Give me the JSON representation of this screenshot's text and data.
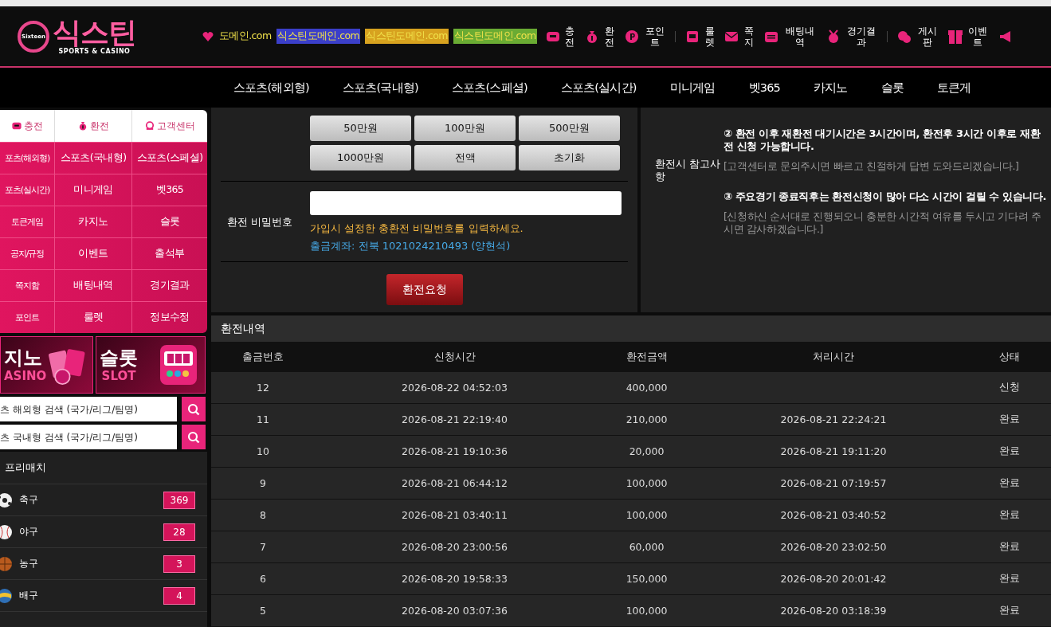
{
  "header": {
    "logo": {
      "badge": "Sixteen",
      "title": "식스틴",
      "subtitle": "SPORTS & CASINO"
    },
    "domains": [
      {
        "text": "도메인.com",
        "color": "#0d0d0d"
      },
      {
        "text": "식스틴도메인.com",
        "color": "#3b3fc9"
      },
      {
        "text": "식스틴도메인.com",
        "color": "#d7a21f"
      },
      {
        "text": "식스틴도메인.com",
        "color": "#6aab33"
      }
    ],
    "quick_links": [
      [
        "충전",
        "환전",
        "포인트"
      ],
      [
        "룰렛",
        "쪽지",
        "배팅내역",
        "경기결과"
      ],
      [
        "게시판",
        "이벤트"
      ]
    ]
  },
  "nav": [
    "스포츠(해외형)",
    "스포츠(국내형)",
    "스포츠(스페셜)",
    "스포츠(실시간)",
    "미니게임",
    "벳365",
    "카지노",
    "슬롯",
    "토큰게"
  ],
  "sidebar": {
    "top_links": [
      "충전",
      "환전",
      "고객센터"
    ],
    "menu": [
      "포츠(해외형)",
      "스포츠(국내형)",
      "스포츠(스페셜)",
      "포츠(실시간)",
      "미니게임",
      "벳365",
      "토큰게임",
      "카지노",
      "슬롯",
      "공지/규정",
      "이벤트",
      "출석부",
      "쪽지함",
      "배팅내역",
      "경기결과",
      "포인트",
      "룰렛",
      "정보수정"
    ],
    "banners": [
      {
        "title": "지노",
        "subtitle": "ASINO"
      },
      {
        "title": "슬롯",
        "subtitle": "SLOT"
      }
    ],
    "searches": [
      {
        "placeholder": "츠 해외형 검색 (국가/리그/팀명)"
      },
      {
        "placeholder": "츠 국내형 검색 (국가/리그/팀명)"
      }
    ],
    "prematch": {
      "title": "프리매치",
      "sports": [
        {
          "name": "축구",
          "count": "369"
        },
        {
          "name": "야구",
          "count": "28"
        },
        {
          "name": "농구",
          "count": "3"
        },
        {
          "name": "배구",
          "count": "4"
        }
      ]
    }
  },
  "withdraw_form": {
    "amount_buttons": [
      "50만원",
      "100만원",
      "500만원",
      "1000만원",
      "전액",
      "초기화"
    ],
    "password": {
      "label": "환전 비밀번호",
      "hint": "가입시 설정한 충환전 비밀번호를 입력하세요.",
      "account": "출금계좌: 전북 1021024210493 (양현석)"
    },
    "submit": "환전요청"
  },
  "notes": {
    "label": "환전시 참고사항",
    "items": [
      {
        "title": "② 환전 이후 재환전 대기시간은 3시간이며, 환전후 3시간 이후로 재환전 신청 가능합니다.",
        "detail": "[고객센터로 문의주시면 빠르고 친절하게 답변 도와드리겠습니다.]"
      },
      {
        "title": "③ 주요경기 종료직후는 환전신청이 많아 다소 시간이 걸릴 수 있습니다.",
        "detail": "[신청하신 순서대로 진행되오니 충분한 시간적 여유를 두시고 기다려 주시면 감사하겠습니다.]"
      }
    ]
  },
  "history": {
    "title": "환전내역",
    "columns": [
      "출금번호",
      "신청시간",
      "환전금액",
      "처리시간",
      "상태"
    ],
    "rows": [
      {
        "no": "12",
        "requested": "2026-08-22 04:52:03",
        "amount": "400,000",
        "status": "신청"
      },
      {
        "no": "11",
        "requested": "2026-08-21 22:19:40",
        "amount": "210,000",
        "processed": "2026-08-21 22:24:21",
        "status": "완료"
      },
      {
        "no": "10",
        "requested": "2026-08-21 19:10:36",
        "amount": "20,000",
        "processed": "2026-08-21 19:11:20",
        "status": "완료"
      },
      {
        "no": "9",
        "requested": "2026-08-21 06:44:12",
        "amount": "100,000",
        "processed": "2026-08-21 07:19:57",
        "status": "완료"
      },
      {
        "no": "8",
        "requested": "2026-08-21 03:40:11",
        "amount": "100,000",
        "processed": "2026-08-21 03:40:52",
        "status": "완료"
      },
      {
        "no": "7",
        "requested": "2026-08-20 23:00:56",
        "amount": "60,000",
        "processed": "2026-08-20 23:02:50",
        "status": "완료"
      },
      {
        "no": "6",
        "requested": "2026-08-20 19:58:33",
        "amount": "150,000",
        "processed": "2026-08-20 20:01:42",
        "status": "완료"
      },
      {
        "no": "5",
        "requested": "2026-08-20 03:07:36",
        "amount": "100,000",
        "processed": "2026-08-20 03:18:39",
        "status": "완료"
      }
    ]
  }
}
